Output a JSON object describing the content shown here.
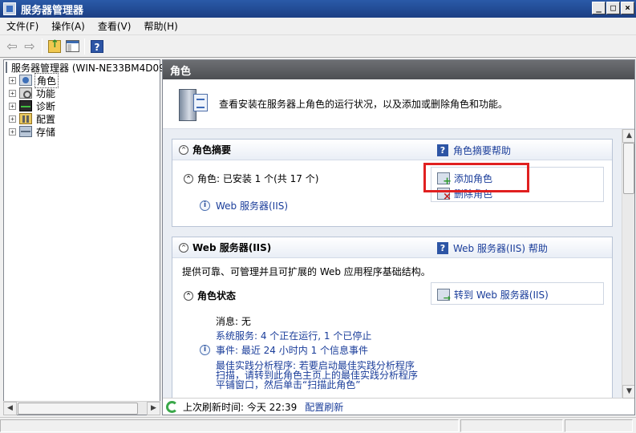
{
  "window": {
    "title": "服务器管理器",
    "controls": [
      "_",
      "□",
      "×"
    ]
  },
  "menu": [
    "文件(F)",
    "操作(A)",
    "查看(V)",
    "帮助(H)"
  ],
  "toolbar": {
    "back_icon": "back-arrow-icon",
    "forward_icon": "forward-arrow-icon",
    "up_icon": "up-folder-icon",
    "panel_icon": "show-hide-console-tree-icon",
    "help_icon": "help-icon",
    "help_glyph": "?"
  },
  "tree": {
    "root": "服务器管理器 (WIN-NE33BM4D09",
    "items": [
      {
        "label": "角色",
        "icon": "roles-icon",
        "selected": true
      },
      {
        "label": "功能",
        "icon": "features-icon"
      },
      {
        "label": "诊断",
        "icon": "diagnostics-icon"
      },
      {
        "label": "配置",
        "icon": "configuration-icon"
      },
      {
        "label": "存储",
        "icon": "storage-icon"
      }
    ]
  },
  "panel": {
    "header": "角色",
    "intro": "查看安装在服务器上角色的运行状况，以及添加或删除角色和功能。",
    "role_summary": {
      "title": "角色摘要",
      "help": "角色摘要帮助",
      "roles_line": "角色: 已安装 1 个(共 17 个)",
      "installed_role": "Web 服务器(IIS)",
      "add_role": "添加角色",
      "remove_role": "删除角色"
    },
    "web_server": {
      "title": "Web 服务器(IIS)",
      "help": "Web 服务器(IIS) 帮助",
      "description": "提供可靠、可管理并且可扩展的 Web 应用程序基础结构。",
      "status_title": "角色状态",
      "goto": "转到 Web 服务器(IIS)",
      "messages": "消息: 无",
      "services": "系统服务: 4 个正在运行, 1 个已停止",
      "events": "事件: 最近 24 小时内 1 个信息事件",
      "bpa_1": "最佳实践分析程序: 若要启动最佳实践分析程序",
      "bpa_2": "扫描，请转到此角色主页上的最佳实践分析程序",
      "bpa_3": "平铺窗口，然后单击“扫描此角色”"
    },
    "refresh": {
      "last_refresh": "上次刷新时间: 今天 22:39",
      "configure": "配置刷新"
    }
  },
  "colors": {
    "title_bar": "#1c3f84",
    "link": "#1a3d9a",
    "highlight": "#e02020",
    "panel_header": "#4d4f53"
  }
}
